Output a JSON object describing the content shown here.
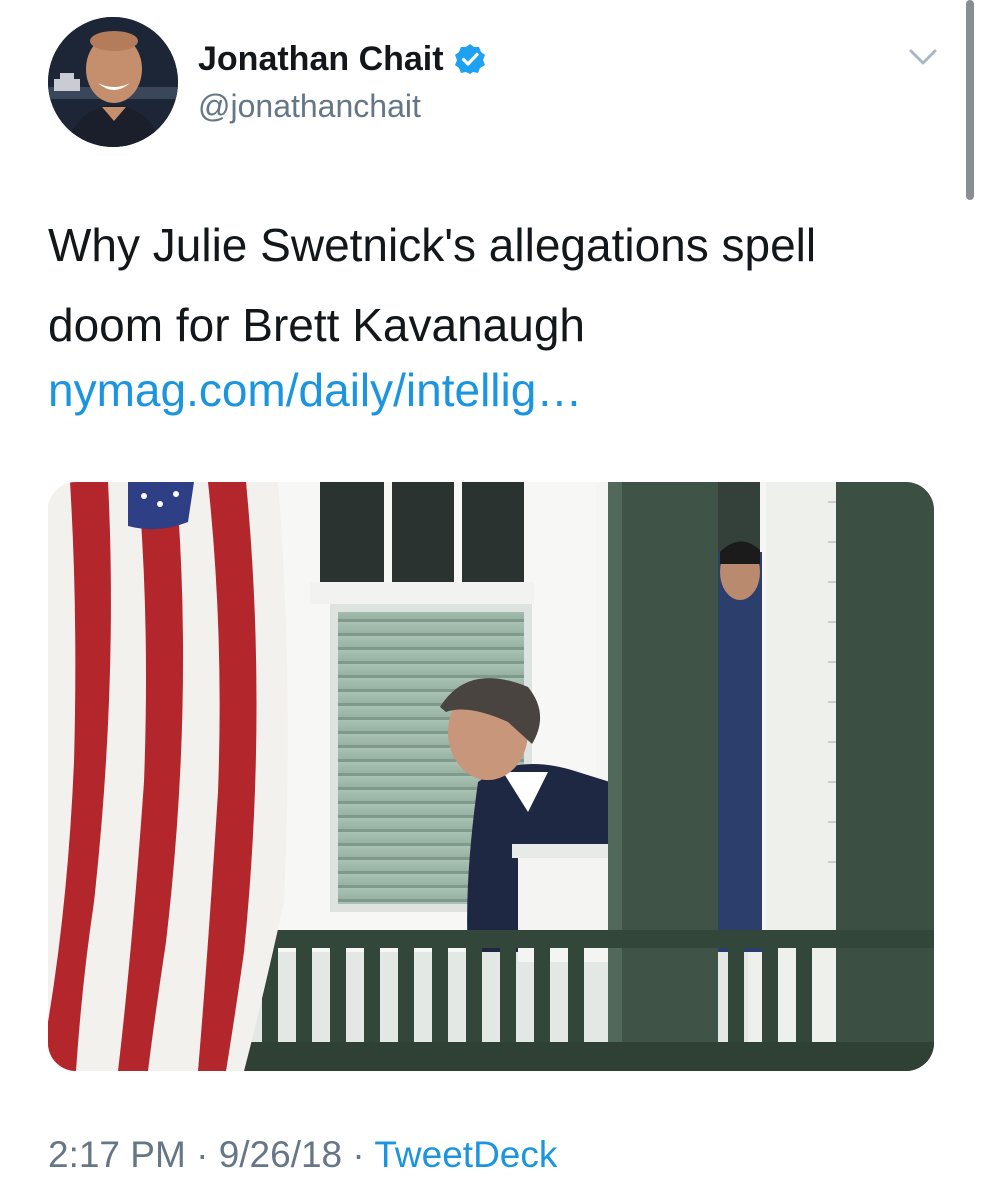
{
  "tweet": {
    "author_name": "Jonathan Chait",
    "author_handle": "@jonathanchait",
    "verified": true,
    "text": "Why Julie Swetnick's allegations spell doom for Brett Kavanaugh",
    "link_text": "nymag.com/daily/intellig…",
    "time": "2:17 PM",
    "date": "9/26/18",
    "separator": "·",
    "source": "TweetDeck"
  },
  "icons": {
    "verified": "verified-badge-icon",
    "menu": "chevron-down-icon"
  },
  "colors": {
    "link": "#1b95e0",
    "secondary_text": "#657786",
    "primary_text": "#14171a",
    "verified_badge": "#1da1f2"
  }
}
